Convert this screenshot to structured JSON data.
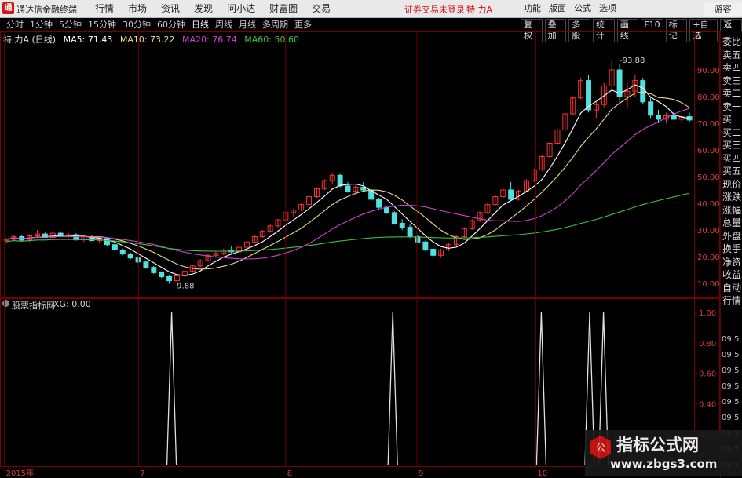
{
  "titlebar": {
    "app_name": "通达信金融终端",
    "menu": [
      "行情",
      "市场",
      "资讯",
      "发现",
      "问小达",
      "财富圈",
      "交易"
    ],
    "status": "证券交易未登录",
    "stock_name": "特 力A",
    "right_menu": [
      "功能",
      "版面",
      "公式",
      "选项"
    ],
    "guest": "游客"
  },
  "toolbar": {
    "periods": [
      "分时",
      "1分钟",
      "5分钟",
      "15分钟",
      "30分钟",
      "60分钟",
      "日线",
      "周线",
      "月线",
      "多周期",
      "更多"
    ],
    "active_period": "日线",
    "right_tools": [
      "复权",
      "叠加",
      "多股",
      "统计",
      "画线",
      "F10",
      "标记",
      "+自选",
      "返回"
    ]
  },
  "ma_legend": {
    "title": "特 力A (日线)",
    "ma5": "MA5: 71.43",
    "ma10": "MA10: 73.22",
    "ma20": "MA20: 76.74",
    "ma60": "MA60: 50.60",
    "colors": {
      "ma5": "#ffffff",
      "ma10": "#e8d890",
      "ma20": "#d040d0",
      "ma60": "#40c040"
    }
  },
  "indicator": {
    "name": "股票指标网",
    "value": "XG: 0.00"
  },
  "price_axis": {
    "ticks": [
      "90.00",
      "80.00",
      "70.00",
      "60.00",
      "50.00",
      "40.00",
      "30.00",
      "20.00",
      "10.00"
    ],
    "high_label": "93.88",
    "low_label": "9.88"
  },
  "indicator_axis": {
    "ticks": [
      "1.00",
      "0.80",
      "0.60",
      "0.40",
      "0.20"
    ]
  },
  "x_axis": {
    "labels": [
      "2015年",
      "7",
      "8",
      "9",
      "10"
    ]
  },
  "right_panel": {
    "labels": [
      "委比",
      "卖五",
      "卖四",
      "卖三",
      "卖二",
      "卖一",
      "买一",
      "买二",
      "买三",
      "买四",
      "买五",
      "现价",
      "涨跌",
      "涨幅",
      "总量",
      "外盘",
      "换手",
      "净资",
      "收益",
      "自动",
      "行情"
    ],
    "times": [
      "09:5",
      "09:5",
      "09:5",
      "09:5",
      "09:5",
      "09:5",
      "09:5",
      "09:5",
      "09:5"
    ]
  },
  "watermark": {
    "line1": "指标公式网",
    "line2": "www.zbgs3.com"
  },
  "chart_data": {
    "type": "candlestick",
    "ylim": [
      5,
      100
    ],
    "ohlc": [
      [
        26,
        27,
        25,
        26.5
      ],
      [
        26.5,
        28,
        26,
        27.5
      ],
      [
        27.5,
        28,
        26,
        26.2
      ],
      [
        26.2,
        28,
        25.5,
        27.8
      ],
      [
        27.8,
        30,
        27,
        28.5
      ],
      [
        28.5,
        29,
        27,
        27.2
      ],
      [
        27.2,
        29.5,
        27,
        28.8
      ],
      [
        28.8,
        29.5,
        27.5,
        27.8
      ],
      [
        27.8,
        29,
        27,
        28.2
      ],
      [
        28.2,
        28.8,
        26,
        26.3
      ],
      [
        26.3,
        28,
        25.5,
        27.5
      ],
      [
        27.5,
        28,
        25.8,
        26
      ],
      [
        26,
        27.5,
        25,
        26.8
      ],
      [
        26.8,
        27,
        24,
        24.5
      ],
      [
        24.5,
        25,
        22,
        22.5
      ],
      [
        22.5,
        23,
        20.5,
        21
      ],
      [
        21,
        21.5,
        19,
        19.5
      ],
      [
        19.5,
        20,
        17.5,
        18
      ],
      [
        18,
        18.5,
        15.5,
        16
      ],
      [
        16,
        16.5,
        13.5,
        14
      ],
      [
        14,
        14.5,
        12,
        12.5
      ],
      [
        12.5,
        13,
        9.88,
        11
      ],
      [
        11,
        13,
        10.5,
        12.8
      ],
      [
        12.8,
        15,
        12.5,
        14.5
      ],
      [
        14.5,
        17,
        14,
        16.5
      ],
      [
        16.5,
        19,
        16,
        18.5
      ],
      [
        18.5,
        21,
        18,
        20.5
      ],
      [
        20.5,
        22,
        19.5,
        21.2
      ],
      [
        21.2,
        23,
        20.5,
        22.5
      ],
      [
        22.5,
        24,
        21,
        21.8
      ],
      [
        21.8,
        24,
        21.5,
        23.5
      ],
      [
        23.5,
        26,
        23,
        25.5
      ],
      [
        25.5,
        28,
        25,
        27.5
      ],
      [
        27.5,
        30,
        27,
        29.5
      ],
      [
        29.5,
        32,
        29,
        31.5
      ],
      [
        31.5,
        34,
        31,
        33.8
      ],
      [
        33.8,
        37,
        33.5,
        36.5
      ],
      [
        36.5,
        38,
        35,
        37.5
      ],
      [
        37.5,
        40,
        37,
        39.5
      ],
      [
        39.5,
        43,
        39,
        42.5
      ],
      [
        42.5,
        46,
        42,
        45.5
      ],
      [
        45.5,
        49,
        45,
        48.5
      ],
      [
        48.5,
        51.5,
        47,
        50.5
      ],
      [
        50.5,
        51,
        46,
        46.5
      ],
      [
        46.5,
        48,
        44,
        44.5
      ],
      [
        44.5,
        47,
        43,
        46
      ],
      [
        46,
        48,
        44.5,
        45
      ],
      [
        45,
        46,
        41,
        41.5
      ],
      [
        41.5,
        42,
        38,
        38.5
      ],
      [
        38.5,
        39,
        36,
        36.5
      ],
      [
        36.5,
        37,
        32,
        32.5
      ],
      [
        32.5,
        34,
        30,
        31
      ],
      [
        31,
        32,
        27,
        27.5
      ],
      [
        27.5,
        28,
        25,
        25.5
      ],
      [
        25.5,
        26,
        22,
        22.8
      ],
      [
        22.8,
        23,
        20,
        20.5
      ],
      [
        20.5,
        23,
        19.5,
        22.5
      ],
      [
        22.5,
        25,
        22,
        24.5
      ],
      [
        24.5,
        28,
        24,
        27.5
      ],
      [
        27.5,
        31,
        27,
        30.5
      ],
      [
        30.5,
        34,
        30,
        33.5
      ],
      [
        33.5,
        37,
        33,
        36.5
      ],
      [
        36.5,
        40,
        36,
        39.5
      ],
      [
        39.5,
        43,
        39,
        42.5
      ],
      [
        42.5,
        46,
        42,
        45
      ],
      [
        45,
        48,
        41,
        41.5
      ],
      [
        41.5,
        45,
        41,
        44.5
      ],
      [
        44.5,
        49,
        44,
        48.5
      ],
      [
        48.5,
        53,
        48,
        52.5
      ],
      [
        52.5,
        58,
        52,
        57.5
      ],
      [
        57.5,
        63,
        57,
        62.5
      ],
      [
        62.5,
        68,
        62,
        67.5
      ],
      [
        67.5,
        74,
        67,
        73.5
      ],
      [
        73.5,
        80,
        73,
        79.5
      ],
      [
        79.5,
        87,
        79,
        86
      ],
      [
        86,
        88,
        74,
        75
      ],
      [
        75,
        78,
        72,
        77
      ],
      [
        77,
        85,
        76,
        84
      ],
      [
        84,
        93.88,
        83,
        90
      ],
      [
        90,
        92,
        78,
        80
      ],
      [
        80,
        85,
        76,
        82
      ],
      [
        82,
        88,
        80,
        86
      ],
      [
        86,
        87,
        77,
        78
      ],
      [
        78,
        80,
        72,
        73
      ],
      [
        73,
        75,
        70,
        71.5
      ],
      [
        71.5,
        74,
        70,
        72.8
      ],
      [
        72.8,
        74,
        71,
        71.5
      ],
      [
        71.5,
        73,
        70,
        72.5
      ],
      [
        72.5,
        74,
        70.5,
        71.2
      ]
    ],
    "signals_x": [
      0.245,
      0.565,
      0.78,
      0.85,
      0.87
    ],
    "signal_values": [
      1,
      1,
      1,
      1,
      1
    ]
  }
}
